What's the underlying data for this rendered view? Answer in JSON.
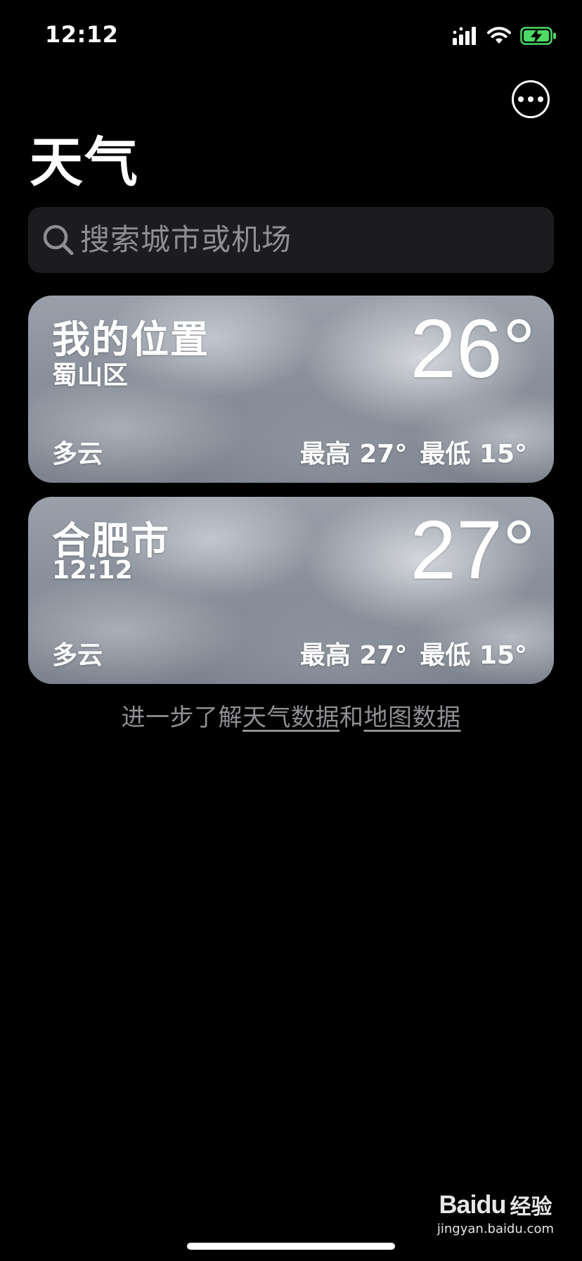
{
  "status_bar": {
    "time": "12:12",
    "icons": [
      "cellular-signal-icon",
      "wifi-icon",
      "battery-charging-icon"
    ],
    "battery_color": "#4cd964"
  },
  "header": {
    "title": "天气",
    "more_icon": "ellipsis-circle-icon"
  },
  "search": {
    "placeholder": "搜索城市或机场",
    "icon": "search-icon"
  },
  "cities": [
    {
      "title": "我的位置",
      "subtitle": "蜀山区",
      "temperature": "26°",
      "condition": "多云",
      "high": "最高 27°",
      "low": "最低 15°"
    },
    {
      "title": "合肥市",
      "subtitle": "12:12",
      "temperature": "27°",
      "condition": "多云",
      "high": "最高 27°",
      "low": "最低 15°"
    }
  ],
  "footer": {
    "prefix": "进一步了解",
    "weather_data_link": "天气数据",
    "and": "和",
    "map_data_link": "地图数据"
  },
  "watermark": {
    "brand": "Baidu",
    "suffix": "经验",
    "url": "jingyan.baidu.com"
  }
}
